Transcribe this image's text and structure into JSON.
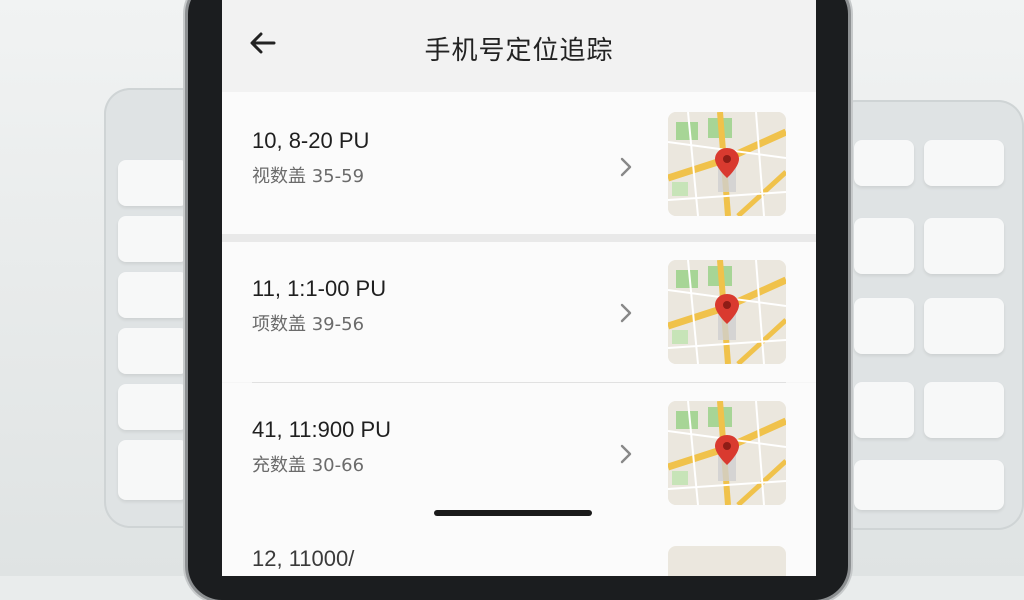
{
  "header": {
    "title": "手机号定位追踪",
    "back_icon": "arrow-left-icon"
  },
  "records": [
    {
      "time": "10, 8-20 PU",
      "detail": "视数盖 35-59",
      "chevron_icon": "chevron-right-icon",
      "map_icon": "map-pin-icon"
    },
    {
      "time": "11, 1:1-00 PU",
      "detail": "项数盖 39-56",
      "chevron_icon": "chevron-right-icon",
      "map_icon": "map-pin-icon"
    },
    {
      "time": "41, 11:900 PU",
      "detail": "充数盖 30-66",
      "chevron_icon": "chevron-right-icon",
      "map_icon": "map-pin-icon"
    }
  ],
  "partial_record": {
    "time": "12, 11000/"
  },
  "colors": {
    "pin": "#d93a2f",
    "road": "#f0c24b",
    "park": "#9fd08c",
    "map_bg": "#ebe7de"
  }
}
